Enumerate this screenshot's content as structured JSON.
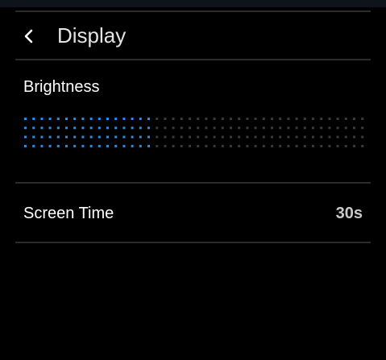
{
  "header": {
    "back_icon": "chevron-left-icon",
    "title": "Display"
  },
  "brightness": {
    "label": "Brightness",
    "level": 0.38,
    "active_color": "#2f8ae0",
    "inactive_color": "#3a3a3a"
  },
  "screen_time": {
    "label": "Screen Time",
    "value": "30s"
  },
  "colors": {
    "background": "#000000",
    "divider": "#2b2b2b"
  }
}
